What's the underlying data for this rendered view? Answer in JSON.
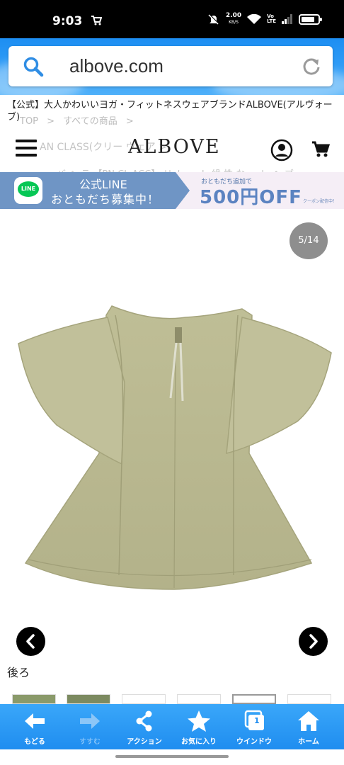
{
  "status_bar": {
    "time": "9:03",
    "net_speed": "2.00",
    "net_unit": "KB/S",
    "volte_top": "Vo",
    "volte_bottom": "LTE"
  },
  "browser": {
    "url": "albove.com"
  },
  "page": {
    "title": "【公式】大人かわいいヨガ・フィットネスウェアブランドALBOVE(アルヴォーブ)",
    "breadcrumb": "TOP > すべての商品 >",
    "breadcrumb_sub": "AN CLASS(クリー                 ウェア    >",
    "breadcrumb_sub2": "バ ヘ テ 【PN CL ACC】 リ ト ー ト 繰 性 な ー レ ヘ ブ",
    "logo": "ALBOVE"
  },
  "line_banner": {
    "title": "公式LINE",
    "subtitle": "おともだち募集中！",
    "logo_text": "LINE",
    "right_small": "おともだち追加で",
    "right_big": "500円OFF",
    "right_note": "クーポン配信中！"
  },
  "gallery": {
    "counter": "5/14",
    "caption": "後ろ",
    "current_index": 5,
    "total": 14
  },
  "toolbar": {
    "items": [
      {
        "label": "もどる",
        "icon": "arrow-left-icon"
      },
      {
        "label": "すすむ",
        "icon": "arrow-right-icon"
      },
      {
        "label": "アクション",
        "icon": "share-icon"
      },
      {
        "label": "お気に入り",
        "icon": "star-icon"
      },
      {
        "label": "ウインドウ",
        "icon": "window-icon",
        "badge": "1"
      },
      {
        "label": "ホーム",
        "icon": "home-icon"
      }
    ]
  },
  "colors": {
    "browser_blue": "#2e9bf6",
    "line_green": "#06c755",
    "banner_blue": "#6f95c5",
    "garment_khaki": "#b9b890"
  }
}
